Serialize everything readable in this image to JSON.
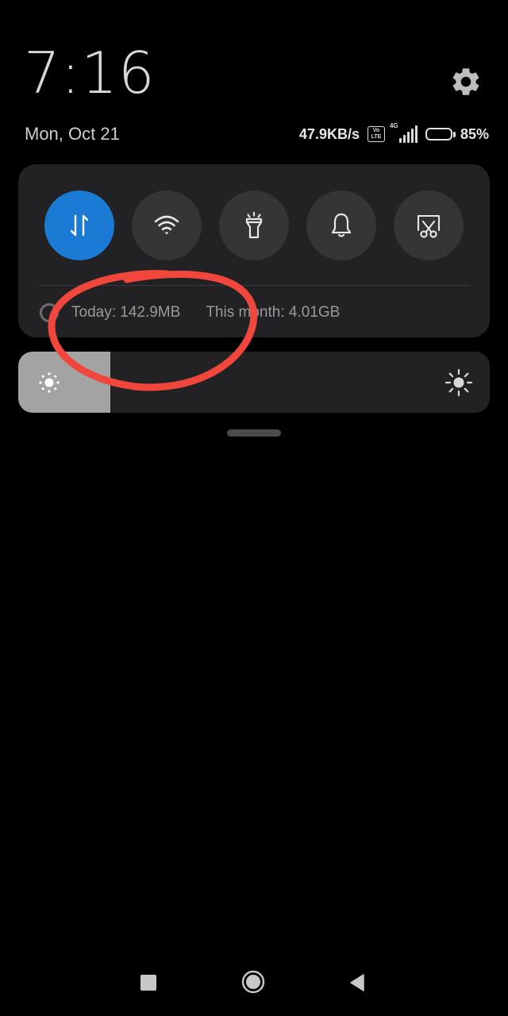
{
  "header": {
    "time": "7:16",
    "date": "Mon, Oct 21"
  },
  "status_bar": {
    "network_speed": "47.9KB/s",
    "volte_top": "Vo",
    "volte_bottom": "LTE",
    "network_type": "4G",
    "battery_percent_label": "85%",
    "battery_level": 0.85
  },
  "quick_toggles": [
    {
      "name": "mobile-data",
      "icon": "data-arrows-icon",
      "active": true
    },
    {
      "name": "wifi",
      "icon": "wifi-icon",
      "active": false
    },
    {
      "name": "flashlight",
      "icon": "flashlight-icon",
      "active": false
    },
    {
      "name": "sound",
      "icon": "bell-icon",
      "active": false
    },
    {
      "name": "screenshot",
      "icon": "screenshot-scissors-icon",
      "active": false
    }
  ],
  "data_usage": {
    "today": "Today: 142.9MB",
    "this_month": "This month: 4.01GB"
  },
  "brightness": {
    "level": 0.195
  },
  "colors": {
    "accent": "#1a7ad4",
    "panel": "#222225",
    "toggle_off": "#353538",
    "annotation": "#f0463c",
    "background": "#000000"
  }
}
